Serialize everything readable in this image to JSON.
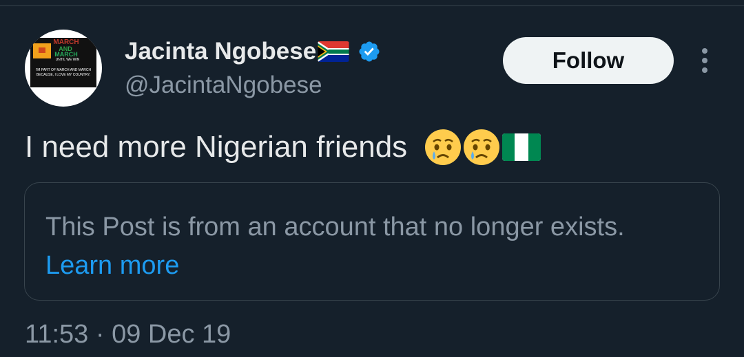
{
  "author": {
    "display_name": "Jacinta Ngobese",
    "handle": "@JacintaNgobese",
    "flag_icon": "south-africa-flag",
    "verified_icon": "verified-badge",
    "avatar_text": {
      "line1": "MARCH",
      "line2": "AND",
      "line3": "MARCH",
      "line4": "UNTIL WE WIN",
      "caption": "I'M PART OF MARCH AND MARCH BECAUSE, I LOVE MY COUNTRY."
    }
  },
  "actions": {
    "follow_label": "Follow",
    "more_icon": "more-vertical-icon"
  },
  "tweet": {
    "text": "I need more Nigerian friends",
    "emojis": [
      "crying-face-emoji",
      "crying-face-emoji",
      "nigeria-flag-emoji"
    ]
  },
  "notice": {
    "text": "This Post is from an account that no longer exists.",
    "link": "Learn more"
  },
  "meta": {
    "time": "11:53",
    "separator": "·",
    "date": "09 Dec 19"
  },
  "colors": {
    "background": "#15202b",
    "primary_text": "#e7e9ea",
    "secondary_text": "#8b98a5",
    "accent": "#1d9bf0",
    "border": "#38444d"
  }
}
